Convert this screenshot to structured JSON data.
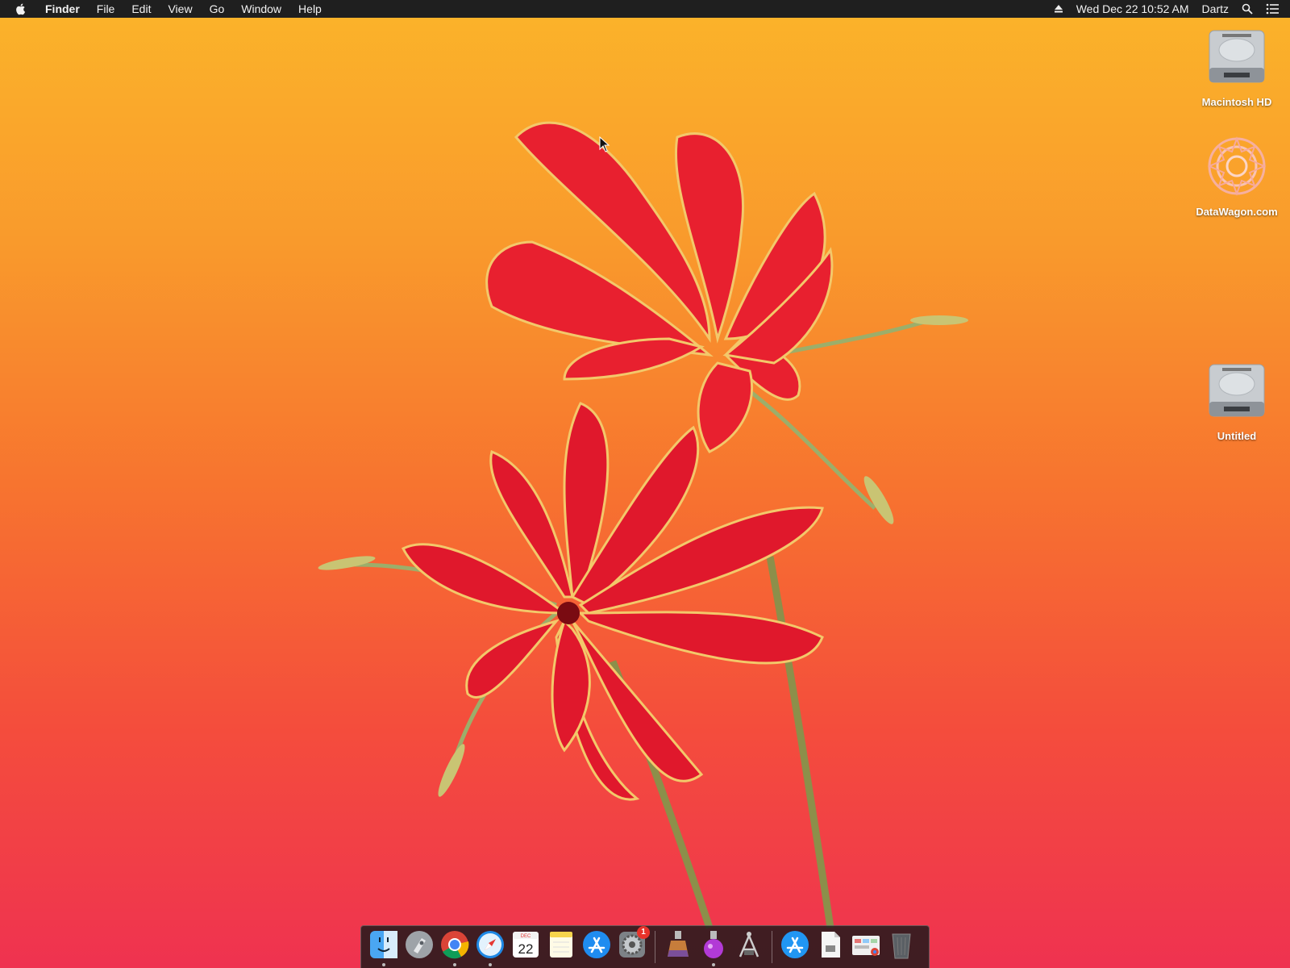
{
  "menubar": {
    "app_name": "Finder",
    "menus": [
      "File",
      "Edit",
      "View",
      "Go",
      "Window",
      "Help"
    ],
    "datetime": "Wed Dec 22  10:52 AM",
    "user": "Dartz",
    "icons": [
      "apple-logo",
      "eject-icon",
      "spotlight-search-icon",
      "notification-center-icon"
    ]
  },
  "desktop": {
    "icons": [
      {
        "label": "Macintosh HD",
        "icon": "hard-drive-icon"
      },
      {
        "label": "DataWagon.com",
        "icon": "mandala-image-icon"
      },
      {
        "label": "Untitled",
        "icon": "hard-drive-icon"
      }
    ]
  },
  "dock": {
    "calendar_day": "22",
    "calendar_month": "DEC",
    "system_preferences_badge": "1",
    "apps": [
      "finder-icon",
      "launchpad-icon",
      "chrome-icon",
      "safari-icon",
      "calendar-icon",
      "notes-icon",
      "app-store-icon",
      "system-preferences-icon",
      "utility-app-1-icon",
      "utility-app-2-icon",
      "utility-app-3-icon",
      "applications-folder-icon",
      "document-icon",
      "chrome-apps-folder-icon",
      "trash-icon"
    ]
  },
  "colors": {
    "menubar_bg": "#1f1f1f",
    "wallpaper_top": "#fbb42a",
    "wallpaper_bottom": "#ef3250",
    "petal": "#e8202f"
  }
}
